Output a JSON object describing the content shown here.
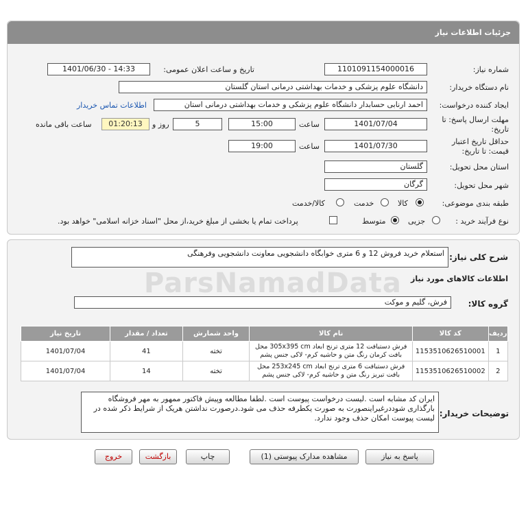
{
  "panel_title": "جزئیات اطلاعات نیاز",
  "fields": {
    "need_number_label": "شماره نیاز:",
    "need_number": "1101091154000016",
    "announce_label": "تاریخ و ساعت اعلان عمومی:",
    "announce_value": "1401/06/30 - 14:33",
    "buyer_org_label": "نام دستگاه خریدار:",
    "buyer_org": "دانشگاه علوم پزشکی و خدمات بهداشتی درمانی استان گلستان",
    "requester_label": "ایجاد کننده درخواست:",
    "requester": "احمد ارنابی حسابدار دانشگاه علوم پزشکی و خدمات بهداشتی درمانی استان",
    "contact_link": "اطلاعات تماس خریدار",
    "deadline_label_1": "مهلت ارسال پاسخ: تا",
    "deadline_label_2": "تاریخ:",
    "deadline_date": "1401/07/04",
    "time_label": "ساعت",
    "deadline_time": "15:00",
    "days": "5",
    "days_label": "روز و",
    "remaining": "01:20:13",
    "remaining_label": "ساعت باقی مانده",
    "validity_label_1": "حداقل تاریخ اعتبار",
    "validity_label_2": "قیمت: تا تاریخ:",
    "validity_date": "1401/07/30",
    "validity_time": "19:00",
    "province_label": "استان محل تحویل:",
    "province": "گلستان",
    "city_label": "شهر محل تحویل:",
    "city": "گرگان",
    "category_label": "طبقه بندی موضوعی:",
    "category_options": [
      "کالا",
      "خدمت",
      "کالا/خدمت"
    ],
    "process_label": "نوع فرآیند خرید :",
    "process_options": [
      "جزیی",
      "متوسط"
    ],
    "payment_note": "پرداخت تمام یا بخشی از مبلغ خرید،از محل \"اسناد خزانه اسلامی\" خواهد بود."
  },
  "summary": {
    "label": "شرح کلی نیاز:",
    "text": "استعلام خرید فروش 12 و 6 متری خوابگاه دانشجویی معاونت دانشجویی وفرهنگی"
  },
  "goods_info_title": "اطلاعات کالاهای مورد نیاز",
  "goods_group_label": "گروه کالا:",
  "goods_group": "فرش، گلیم و موکت",
  "table": {
    "headers": [
      "ردیف",
      "کد کالا",
      "نام کالا",
      "واحد شمارش",
      "تعداد / مقدار",
      "تاریخ نیاز"
    ],
    "rows": [
      [
        "1",
        "1153510626510001",
        "فرش دستبافت 12 متری ترنج ابعاد 305x395 cm محل بافت کرمان رنگ متن و حاشیه کرم- لاکی جنس پشم",
        "تخته",
        "41",
        "1401/07/04"
      ],
      [
        "2",
        "1153510626510002",
        "فرش دستبافت 6 متری ترنج ابعاد 253x245 cm محل بافت تبریز رنگ متن و حاشیه کرم- لاکی جنس پشم",
        "تخته",
        "14",
        "1401/07/04"
      ]
    ]
  },
  "buyer_notes": {
    "label": "توضیحات خریدار:",
    "text": "ایران کد مشابه است .لیست درخواست پیوست است .لطفا مطالعه وپیش فاکتور ممهور به مهر فروشگاه بارگذاری شوددرغیراینصورت به صورت یکطرفه حذف می شود.درصورت نداشتن هریک از شرایط ذکر شده در لیست پیوست امکان حذف وجود ندارد."
  },
  "buttons": {
    "reply": "پاسخ به نیاز",
    "attachments": "مشاهده مدارک پیوستی (1)",
    "print": "چاپ",
    "back": "بازگشت",
    "exit": "خروج"
  },
  "watermark": "ParsNamadData",
  "colors": {
    "header": "#8d8d8d",
    "link": "#1a56b0",
    "danger": "#c00000"
  }
}
